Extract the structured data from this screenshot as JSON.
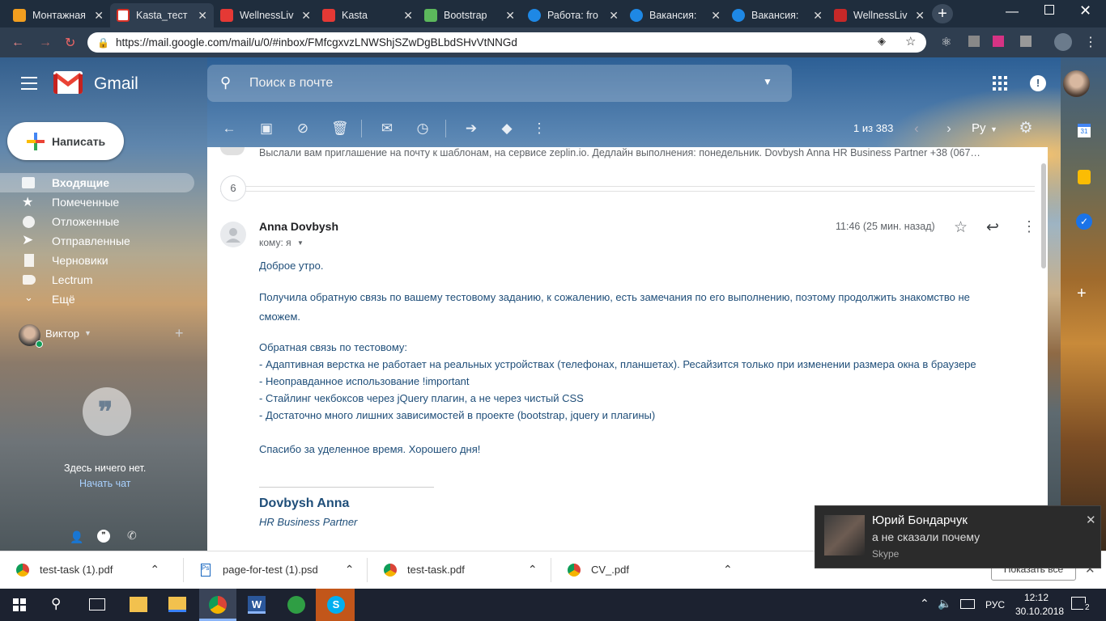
{
  "browser": {
    "tabs": [
      {
        "title": "Монтажная",
        "fav_color": "#f29e1f"
      },
      {
        "title": "Kasta_тест",
        "fav_color": "#d93025"
      },
      {
        "title": "WellnessLiv",
        "fav_color": "#e53935"
      },
      {
        "title": "Kasta",
        "fav_color": "#e53935"
      },
      {
        "title": "Bootstrap",
        "fav_color": "#5cb85c"
      },
      {
        "title": "Работа: fro",
        "fav_color": "#1e88e5"
      },
      {
        "title": "Вакансия:",
        "fav_color": "#1e88e5"
      },
      {
        "title": "Вакансия:",
        "fav_color": "#1e88e5"
      },
      {
        "title": "WellnessLiv",
        "fav_color": "#c62828"
      }
    ],
    "url": "https://mail.google.com/mail/u/0/#inbox/FMfcgxvzLNWShjSZwDgBLbdSHvVtNNGd"
  },
  "gmail": {
    "logo_text": "Gmail",
    "search_placeholder": "Поиск в почте",
    "compose_label": "Написать",
    "nav": [
      {
        "label": "Входящие",
        "icon": "inbox-icon",
        "selected": true
      },
      {
        "label": "Помеченные",
        "icon": "star-icon"
      },
      {
        "label": "Отложенные",
        "icon": "clock-icon"
      },
      {
        "label": "Отправленные",
        "icon": "send-icon"
      },
      {
        "label": "Черновики",
        "icon": "draft-icon"
      },
      {
        "label": "Lectrum",
        "icon": "label-icon"
      },
      {
        "label": "Ещё",
        "icon": "chevron-down-icon"
      }
    ],
    "hangouts": {
      "user": "Виктор",
      "empty_text": "Здесь ничего нет.",
      "start_chat": "Начать чат"
    },
    "pagination": "1 из 383",
    "lang": "Ру"
  },
  "thread": {
    "prev_snippet": "Выслали вам приглашение на почту к шаблонам, на сервисе zeplin.io. Дедлайн выполнения: понедельник. Dovbysh Anna HR Business Partner +38 (067…",
    "collapsed_count": "6",
    "sender": "Anna Dovbysh",
    "to": "кому: я",
    "time": "11:46 (25 мин. назад)",
    "body": [
      "Доброе утро.",
      "Получила обратную связь по вашему тестовому заданию, к сожалению, есть замечания по его выполнению, поэтому продолжить знакомство не",
      "сможем.",
      "Обратная связь по тестовому:",
      "- Адаптивная верстка не работает на реальных устройствах (телефонах, планшетах). Ресайзится только при изменении размера окна в браузере",
      "- Неоправданное использование !important",
      "- Стайлинг чекбоксов через jQuery плагин, а не через чистый CSS",
      "- Достаточно много лишних зависимостей в проекте (bootstrap, jquery и плагины)",
      "Спасибо за уделенное время. Хорошего дня!"
    ],
    "signature_name": "Dovbysh Anna",
    "signature_title": "HR Business Partner"
  },
  "downloads": [
    {
      "name": "test-task (1).pdf"
    },
    {
      "name": "page-for-test (1).psd"
    },
    {
      "name": "test-task.pdf"
    },
    {
      "name": "CV_.pdf"
    }
  ],
  "toast": {
    "title": "Юрий Бондарчук",
    "message": "а не сказали почему",
    "app": "Skype",
    "show_all": "Показать все"
  },
  "taskbar": {
    "lang": "РУС",
    "time": "12:12",
    "date": "30.10.2018",
    "notif_count": "2"
  },
  "colors": {
    "gmail_red": "#ea4335",
    "link_blue": "#1a73e8",
    "signature_blue": "#1f4e79"
  }
}
